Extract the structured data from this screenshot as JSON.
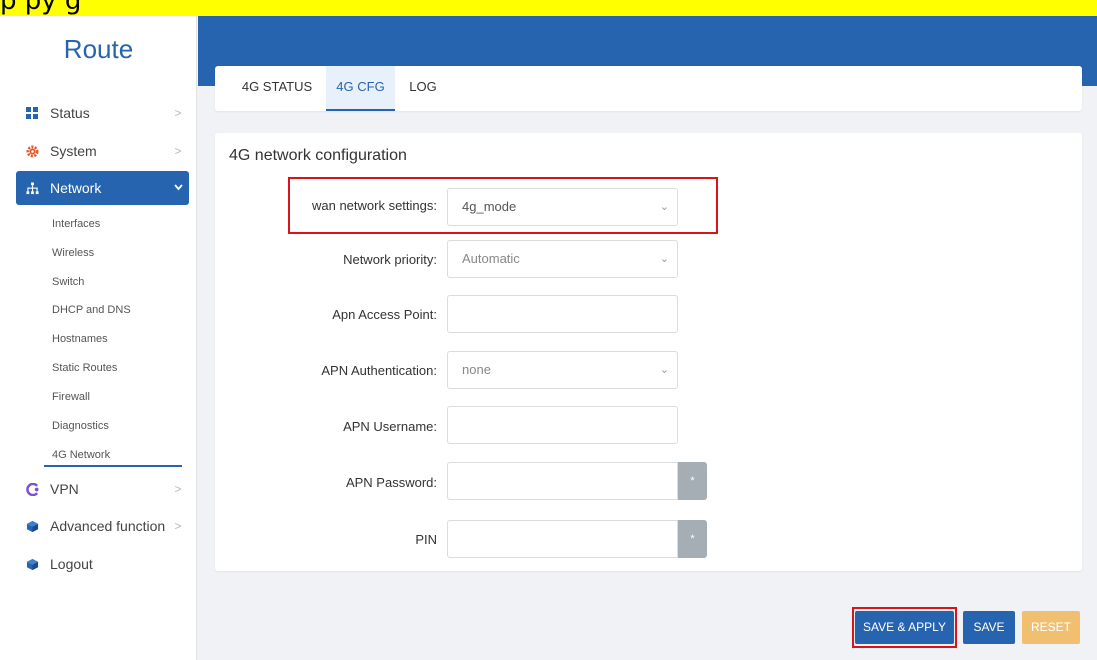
{
  "top_banner_text": "p              py                                                             g",
  "sidebar": {
    "brand": "Route",
    "items": [
      {
        "label": "Status",
        "icon": "dashboard-icon"
      },
      {
        "label": "System",
        "icon": "gear-icon"
      },
      {
        "label": "Network",
        "icon": "network-icon"
      },
      {
        "label": "VPN",
        "icon": "vpn-icon"
      },
      {
        "label": "Advanced function",
        "icon": "cube-icon"
      },
      {
        "label": "Logout",
        "icon": "cube-icon"
      }
    ],
    "network_subitems": [
      "Interfaces",
      "Wireless",
      "Switch",
      "DHCP and DNS",
      "Hostnames",
      "Static Routes",
      "Firewall",
      "Diagnostics",
      "4G Network"
    ]
  },
  "tabs": [
    "4G STATUS",
    "4G CFG",
    "LOG"
  ],
  "form": {
    "title": "4G network configuration",
    "fields": {
      "wan": {
        "label": "wan network settings:",
        "value": "4g_mode"
      },
      "priority": {
        "label": "Network priority:",
        "value": "Automatic"
      },
      "apn_ap": {
        "label": "Apn Access Point:",
        "value": ""
      },
      "apn_auth": {
        "label": "APN Authentication:",
        "value": "none"
      },
      "apn_user": {
        "label": "APN Username:",
        "value": ""
      },
      "apn_pass": {
        "label": "APN Password:",
        "value": ""
      },
      "pin": {
        "label": "PIN",
        "value": ""
      }
    },
    "reveal_glyph": "*"
  },
  "buttons": {
    "save_apply": "SAVE & APPLY",
    "save": "SAVE",
    "reset": "RESET"
  },
  "colors": {
    "accent": "#2764b0",
    "highlight_border": "#d9131c",
    "reset_button": "#f0c070",
    "banner": "#ffff00"
  }
}
